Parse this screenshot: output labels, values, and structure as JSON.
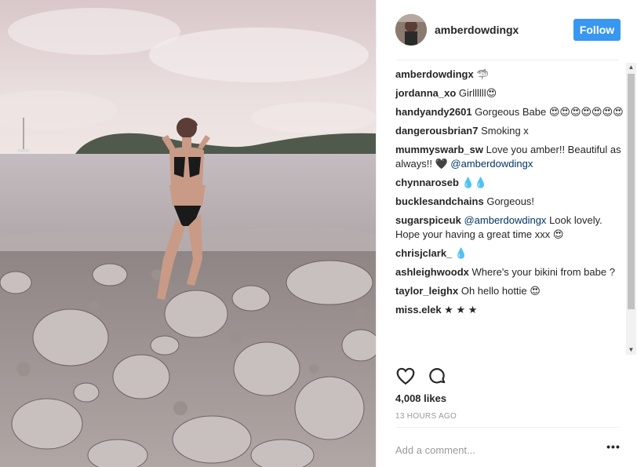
{
  "post": {
    "username": "amberdowdingx",
    "follow_label": "Follow",
    "likes": "4,008 likes",
    "time": "13 HOURS AGO",
    "add_comment_placeholder": "Add a comment...",
    "more_label": "•••"
  },
  "comments": [
    {
      "user": "amberdowdingx",
      "text": "🦈"
    },
    {
      "user": "jordanna_xo",
      "text": "Girllllll😍"
    },
    {
      "user": "handyandy2601",
      "text": "Gorgeous Babe 😍😍😍😍😍😍😍"
    },
    {
      "user": "dangerousbrian7",
      "text": "Smoking x"
    },
    {
      "user": "mummyswarb_sw",
      "text": "Love you amber!! Beautiful as always!! 🖤",
      "mention": "@amberdowdingx"
    },
    {
      "user": "chynnaroseb",
      "text": "💧💧"
    },
    {
      "user": "bucklesandchains",
      "text": "Gorgeous!"
    },
    {
      "user": "sugarspiceuk",
      "mention_first": "@amberdowdingx",
      "text": "Look lovely. Hope your having a great time xxx 😍"
    },
    {
      "user": "chrisjclark_",
      "text": "💧"
    },
    {
      "user": "ashleighwoodx",
      "text": "Where's your bikini from babe ?"
    },
    {
      "user": "taylor_leighx",
      "text": "Oh hello hottie 😍"
    },
    {
      "user": "miss.elek",
      "text": "★ ★ ★"
    }
  ],
  "icons": {
    "heart": "heart-icon",
    "comment": "comment-icon"
  },
  "colors": {
    "follow_button": "#3897f0",
    "mention": "#003569"
  }
}
